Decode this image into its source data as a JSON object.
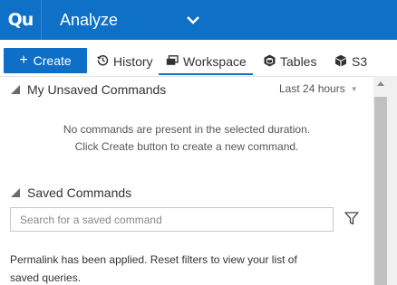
{
  "header": {
    "logo_text": "Qu",
    "title": "Analyze",
    "chevron_icon": "chevron-down-icon"
  },
  "toolbar": {
    "create_label": "Create",
    "create_icon": "plus-icon"
  },
  "tabs": [
    {
      "label": "History",
      "icon": "history-icon",
      "active": false
    },
    {
      "label": "Workspace",
      "icon": "workspace-icon",
      "active": true
    },
    {
      "label": "Tables",
      "icon": "tables-icon",
      "active": false
    },
    {
      "label": "S3",
      "icon": "s3-cube-icon",
      "active": false
    }
  ],
  "unsaved": {
    "title": "My Unsaved Commands",
    "range_label": "Last 24 hours",
    "empty_line1": "No commands are present in the selected duration.",
    "empty_line2": "Click Create button to create a new command."
  },
  "saved": {
    "title": "Saved Commands",
    "search_placeholder": "Search for a saved command",
    "search_value": "",
    "filter_icon": "filter-icon",
    "permalink_message": "Permalink has been applied. Reset filters to view your list of saved queries."
  },
  "colors": {
    "brand": "#0e70c6",
    "accent_underline": "#1a6fb8"
  }
}
